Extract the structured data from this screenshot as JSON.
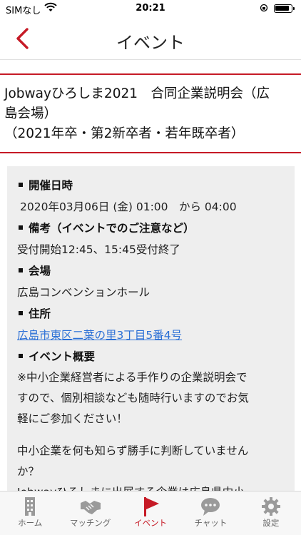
{
  "status_bar": {
    "carrier": "SIMなし",
    "time": "20:21"
  },
  "nav": {
    "title": "イベント"
  },
  "event": {
    "title_lines": [
      "Jobwayひろしま2021　合同企業説明会（広",
      "島会場）",
      "（2021年卒・第2新卒者・若年既卒者）"
    ]
  },
  "details": {
    "datetime_heading": "開催日時",
    "datetime_value": "2020年03月06日 (金)  01:00　から  04:00",
    "notes_heading": "備考（イベントでのご注意など）",
    "notes_value": "受付開始12:45、15:45受付終了",
    "venue_heading": "会場",
    "venue_value": "広島コンベンションホール",
    "address_heading": "住所",
    "address_value": "広島市東区二葉の里3丁目5番4号",
    "overview_heading": "イベント概要",
    "overview_lines": [
      "※中小企業経営者による手作りの企業説明会で",
      "すので、個別相談なども随時行いますのでお気",
      "軽にご参加ください！"
    ],
    "overview_lines2": [
      "中小企業を何も知らず勝手に判断していません",
      "か？",
      "Jobwayひろしまに出展する企業は広島県中小"
    ]
  },
  "tabs": [
    {
      "label": "ホーム",
      "icon": "building-icon"
    },
    {
      "label": "マッチング",
      "icon": "handshake-icon"
    },
    {
      "label": "イベント",
      "icon": "flag-icon"
    },
    {
      "label": "チャット",
      "icon": "chat-bubble-icon"
    },
    {
      "label": "設定",
      "icon": "gear-icon"
    }
  ],
  "colors": {
    "accent": "#c61a26",
    "panel": "#eeeeee",
    "link": "#2a6fd6",
    "tab_inactive": "#9a9a9a"
  }
}
